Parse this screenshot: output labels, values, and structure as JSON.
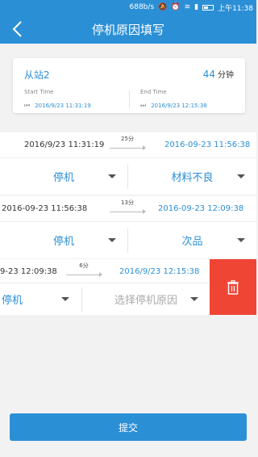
{
  "status_bar": {
    "speed": "688b/s",
    "time": "上午11:38"
  },
  "header": {
    "title": "停机原因填写"
  },
  "summary": {
    "station": "从站2",
    "duration": "44",
    "duration_unit": "分钟",
    "start_label": "Start Time",
    "start_time": "2016/9/23 11:31:19",
    "end_label": "End Time",
    "end_time": "2016/9/23 12:15:38"
  },
  "records": [
    {
      "start": "2016/9/23 11:31:19",
      "gap": "25分",
      "end": "2016-09-23 11:56:38",
      "type": "停机",
      "reason": "材料不良"
    },
    {
      "start": "2016-09-23 11:56:38",
      "gap": "13分",
      "end": "2016-09-23 12:09:38",
      "type": "停机",
      "reason": "次品"
    },
    {
      "start": "9-23 12:09:38",
      "gap": "6分",
      "end": "2016/9/23 12:15:38",
      "type": "停机",
      "reason_placeholder": "选择停机原因"
    }
  ],
  "submit_label": "提交",
  "colors": {
    "primary": "#2b8fd6",
    "delete": "#ef4535"
  }
}
